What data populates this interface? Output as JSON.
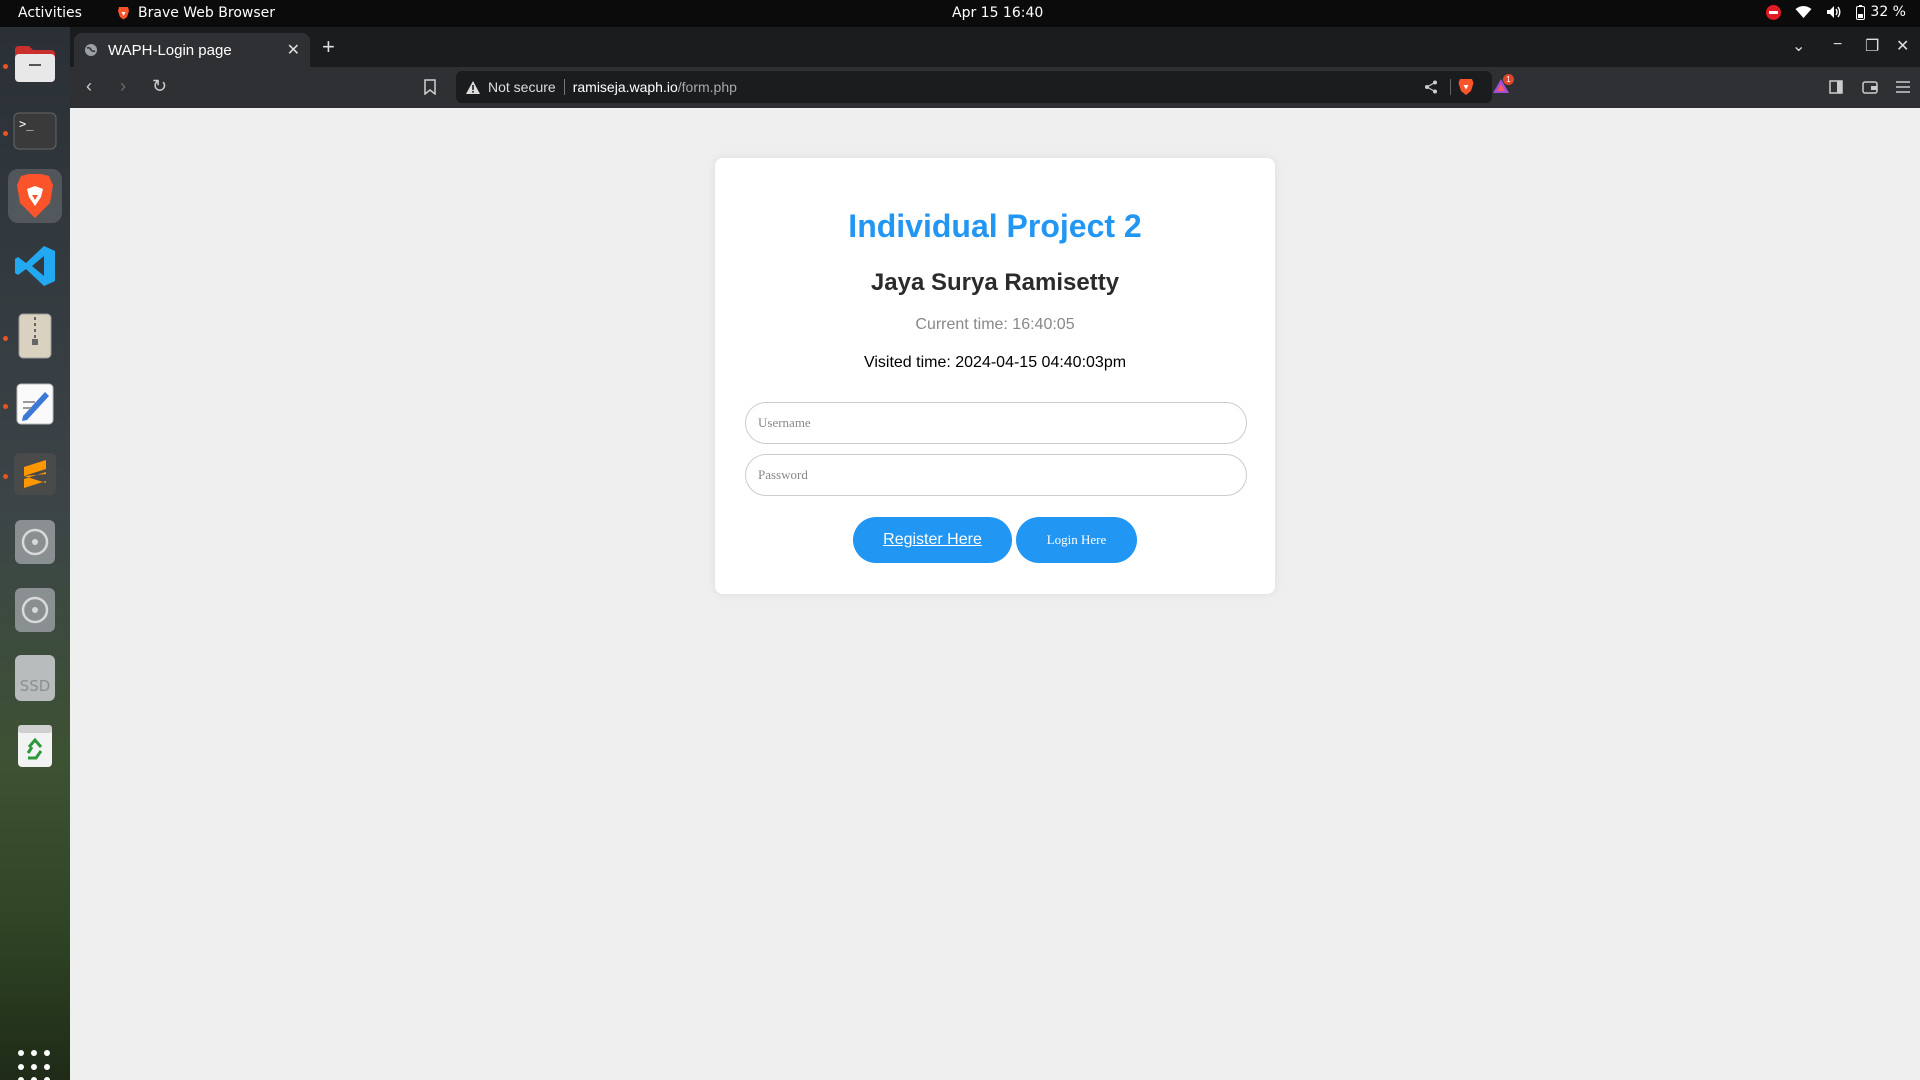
{
  "topbar": {
    "activities": "Activities",
    "app_name": "Brave Web Browser",
    "datetime": "Apr 15  16:40",
    "battery": "32 %"
  },
  "browser": {
    "tab_title": "WAPH-Login page",
    "security_label": "Not secure",
    "url_host": "ramiseja.waph.io",
    "url_path": "/form.php",
    "rewards_badge": "1"
  },
  "page": {
    "title": "Individual Project 2",
    "author": "Jaya Surya Ramisetty",
    "current_time": "Current time: 16:40:05",
    "visited_time": "Visited time: 2024-04-15 04:40:03pm",
    "username_placeholder": "Username",
    "password_placeholder": "Password",
    "register_label": "Register Here",
    "login_label": "Login Here"
  },
  "dock": {
    "items": [
      "files-icon",
      "terminal-icon",
      "brave-icon",
      "vscode-icon",
      "archive-icon",
      "text-editor-icon",
      "sublime-icon",
      "disc-icon",
      "disc-icon",
      "ssd-drive-icon",
      "trash-icon"
    ],
    "ssd_label": "SSD"
  },
  "colors": {
    "accent": "#2196f3",
    "brave": "#fb542b",
    "ubuntu_orange": "#e95420"
  }
}
